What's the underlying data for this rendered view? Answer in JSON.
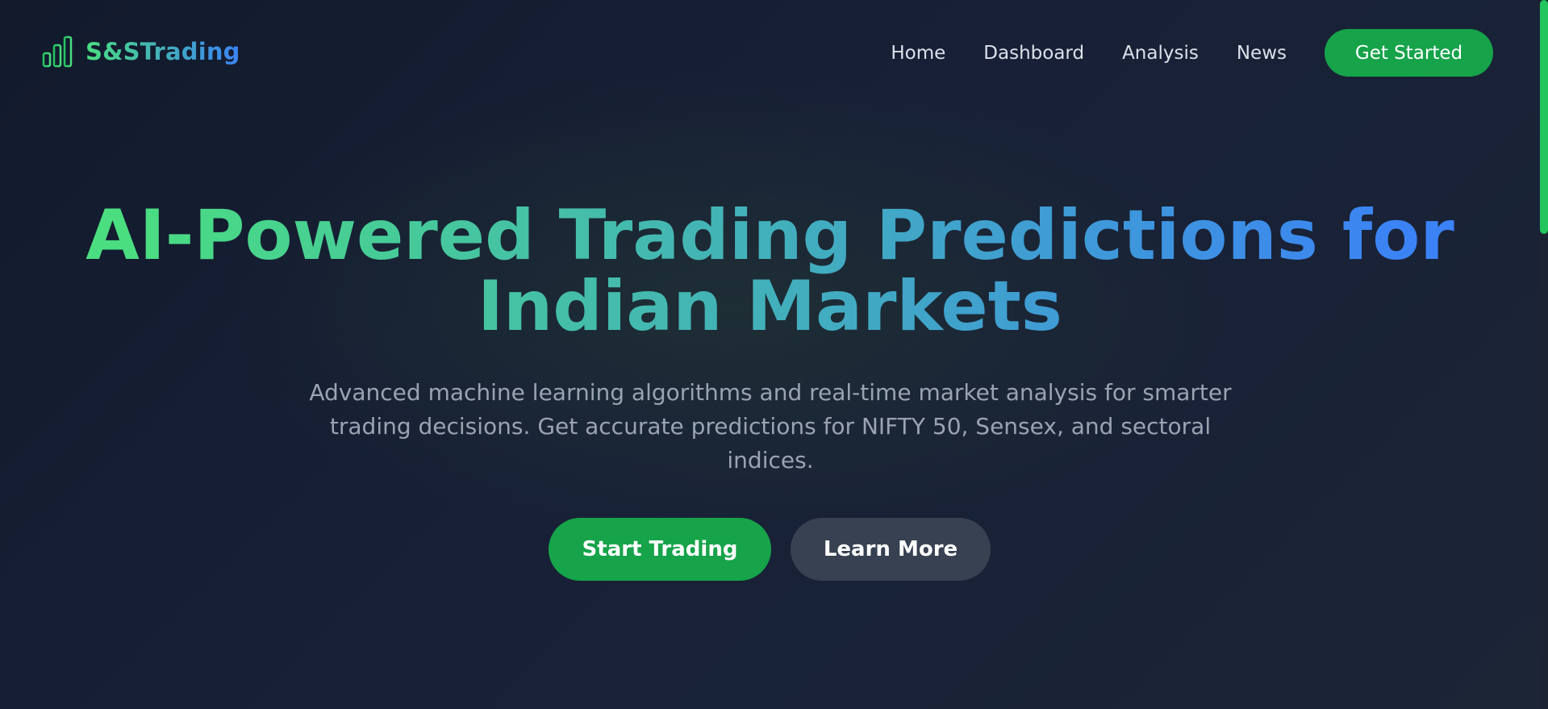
{
  "brand": {
    "name": "S&STrading",
    "logo_icon": "bar-chart-icon",
    "gradient_start": "#4ade80",
    "gradient_end": "#3b82f6"
  },
  "nav": {
    "items": [
      {
        "label": "Home"
      },
      {
        "label": "Dashboard"
      },
      {
        "label": "Analysis"
      },
      {
        "label": "News"
      }
    ],
    "cta_label": "Get Started"
  },
  "hero": {
    "title_line1": "AI-Powered Trading Predictions for",
    "title_line2": "Indian Markets",
    "subtitle": "Advanced machine learning algorithms and real-time market analysis for smarter trading decisions. Get accurate predictions for NIFTY 50, Sensex, and sectoral indices.",
    "primary_cta": "Start Trading",
    "secondary_cta": "Learn More"
  },
  "colors": {
    "accent_green": "#16a34a",
    "secondary_button": "#374151",
    "background": "#151d30"
  }
}
